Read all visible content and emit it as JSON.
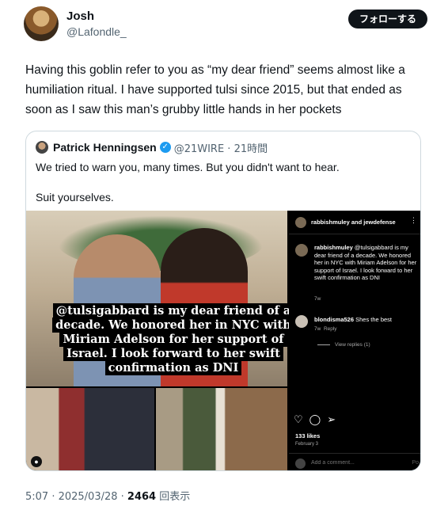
{
  "author": {
    "name": "Josh",
    "handle": "@Lafondle_"
  },
  "follow_label": "フォローする",
  "tweet_text": "Having this goblin refer to you as “my dear friend” seems almost like a humiliation ritual. I have supported tulsi since 2015, but that ended as soon as I saw this man’s grubby little hands in her pockets",
  "quoted": {
    "name": "Patrick Henningsen",
    "verified_glyph": "✓",
    "meta": "@21WIRE · 21時間",
    "text_line1": "We tried to warn you, many times. But you didn't want to hear.",
    "text_line2": "Suit yourselves.",
    "image_caption": "@tulsigabbard is my dear friend of a decade. We honored her in NYC with Miriam Adelson for her support of Israel. I look forward to her swift confirmation as DNI",
    "instagram": {
      "header": "rabbishmuley and jewdefense",
      "more_glyph": "⋮",
      "comment1_user": "rabbishmuley",
      "comment1_text": "@tulsigabbard is my dear friend of a decade. We honored her in NYC with Miriam Adelson for her support of Israel. I look forward to her swift confirmation as DNI",
      "comment1_time": "7w",
      "comment2_user": "blondisma526",
      "comment2_text": "Shes the best",
      "comment2_time": "7w",
      "comment2_reply": "Reply",
      "view_replies": "View replies (1)",
      "like_glyph": "♡",
      "comment_glyph": "◯",
      "share_glyph": "➢",
      "likes": "133 likes",
      "date": "February 3",
      "comment_placeholder": "Add a comment...",
      "post_label": "Po"
    },
    "user_tag_glyph": "●"
  },
  "footer": {
    "time_date": "5:07 · 2025/03/28 · ",
    "views_count": "2464",
    "views_label": " 回表示"
  }
}
